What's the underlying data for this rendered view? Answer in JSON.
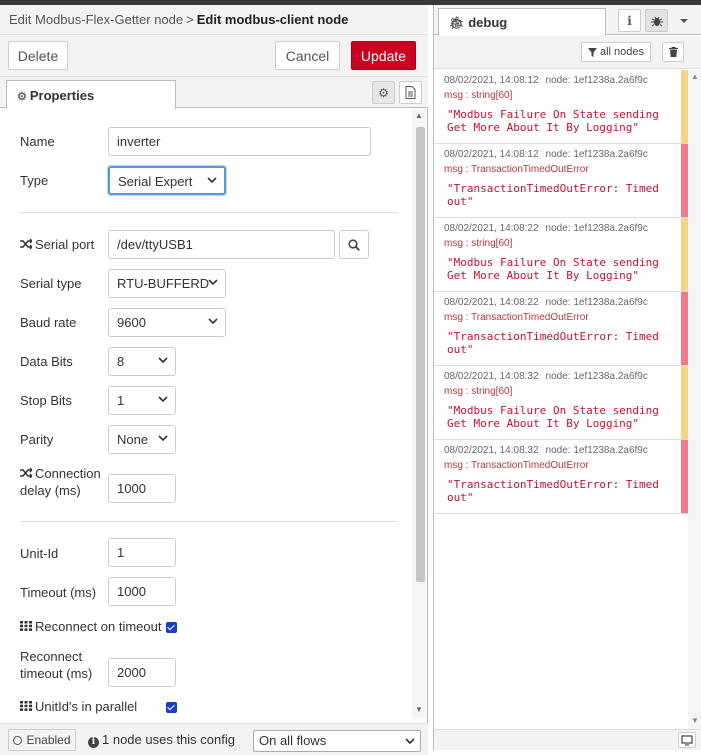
{
  "header": {
    "breadcrumb_parent": "Edit Modbus-Flex-Getter node",
    "breadcrumb_sep": ">",
    "title": "Edit modbus-client node"
  },
  "actions": {
    "delete": "Delete",
    "cancel": "Cancel",
    "update": "Update"
  },
  "tabs": {
    "properties": "Properties"
  },
  "form": {
    "name_label": "Name",
    "name_value": "inverter",
    "type_label": "Type",
    "type_value": "Serial Expert",
    "serial_port_label": "Serial port",
    "serial_port_value": "/dev/ttyUSB1",
    "serial_type_label": "Serial type",
    "serial_type_value": "RTU-BUFFERD",
    "baud_rate_label": "Baud rate",
    "baud_rate_value": "9600",
    "data_bits_label": "Data Bits",
    "data_bits_value": "8",
    "stop_bits_label": "Stop Bits",
    "stop_bits_value": "1",
    "parity_label": "Parity",
    "parity_value": "None",
    "connection_delay_label_1": "Connection",
    "connection_delay_label_2": "delay (ms)",
    "connection_delay_value": "1000",
    "unit_id_label": "Unit-Id",
    "unit_id_value": "1",
    "timeout_label": "Timeout (ms)",
    "timeout_value": "1000",
    "reconnect_on_timeout_label": "Reconnect on timeout",
    "reconnect_timeout_label_1": "Reconnect",
    "reconnect_timeout_label_2": "timeout (ms)",
    "reconnect_timeout_value": "2000",
    "unitids_parallel_label": "UnitId's in parallel"
  },
  "footer": {
    "enabled": "Enabled",
    "usage": "1 node uses this config",
    "flows_value": "On all flows"
  },
  "debug": {
    "tab": "debug",
    "filter": "all nodes",
    "messages": [
      {
        "time": "08/02/2021, 14:08:12",
        "node": "node: 1ef1238a.2a6f9c",
        "topic": "msg : string[60]",
        "payload_1": "\"Modbus Failure On State sending",
        "payload_2": "Get More About It By Logging\"",
        "level": "warn"
      },
      {
        "time": "08/02/2021, 14:08:12",
        "node": "node: 1ef1238a.2a6f9c",
        "topic": "msg : TransactionTimedOutError",
        "payload_1": "\"TransactionTimedOutError: Timed",
        "payload_2": "out\"",
        "level": "err"
      },
      {
        "time": "08/02/2021, 14:08:22",
        "node": "node: 1ef1238a.2a6f9c",
        "topic": "msg : string[60]",
        "payload_1": "\"Modbus Failure On State sending",
        "payload_2": "Get More About It By Logging\"",
        "level": "warn"
      },
      {
        "time": "08/02/2021, 14:08:22",
        "node": "node: 1ef1238a.2a6f9c",
        "topic": "msg : TransactionTimedOutError",
        "payload_1": "\"TransactionTimedOutError: Timed",
        "payload_2": "out\"",
        "level": "err"
      },
      {
        "time": "08/02/2021, 14:08:32",
        "node": "node: 1ef1238a.2a6f9c",
        "topic": "msg : string[60]",
        "payload_1": "\"Modbus Failure On State sending",
        "payload_2": "Get More About It By Logging\"",
        "level": "warn"
      },
      {
        "time": "08/02/2021, 14:08:32",
        "node": "node: 1ef1238a.2a6f9c",
        "topic": "msg : TransactionTimedOutError",
        "payload_1": "\"TransactionTimedOutError: Timed",
        "payload_2": "out\"",
        "level": "err"
      }
    ]
  },
  "colors": {
    "primary": "#c9001f",
    "warn": "#f6d48a",
    "error": "#f07a86",
    "checkbox": "#1a3fc7"
  },
  "icons": [
    "gear-icon",
    "document-icon",
    "shuffle-icon",
    "search-icon",
    "grid-icon",
    "info-icon",
    "bug-icon",
    "chevron-down-icon",
    "filter-icon",
    "trash-icon",
    "monitor-icon"
  ]
}
